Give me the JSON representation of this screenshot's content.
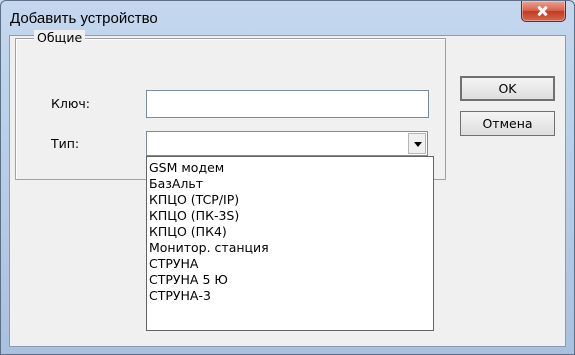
{
  "window": {
    "title": "Добавить устройство"
  },
  "group": {
    "legend": "Общие"
  },
  "fields": {
    "key_label": "Ключ:",
    "key_value": "",
    "type_label": "Тип:",
    "type_value": ""
  },
  "dropdown": {
    "items": [
      "GSM модем",
      "БазАльт",
      "КПЦО (TCP/IP)",
      "КПЦО (ПК-3S)",
      "КПЦО (ПК4)",
      "Монитор. станция",
      "СТРУНА",
      "СТРУНА 5 Ю",
      "СТРУНА-3"
    ]
  },
  "buttons": {
    "ok": "OK",
    "cancel": "Отмена"
  },
  "colors": {
    "title_bar": "#b4cbe6",
    "close_button": "#c2391f",
    "client_bg": "#f0f0f0"
  },
  "icons": {
    "close": "close-icon",
    "dropdown": "chevron-down-icon"
  }
}
